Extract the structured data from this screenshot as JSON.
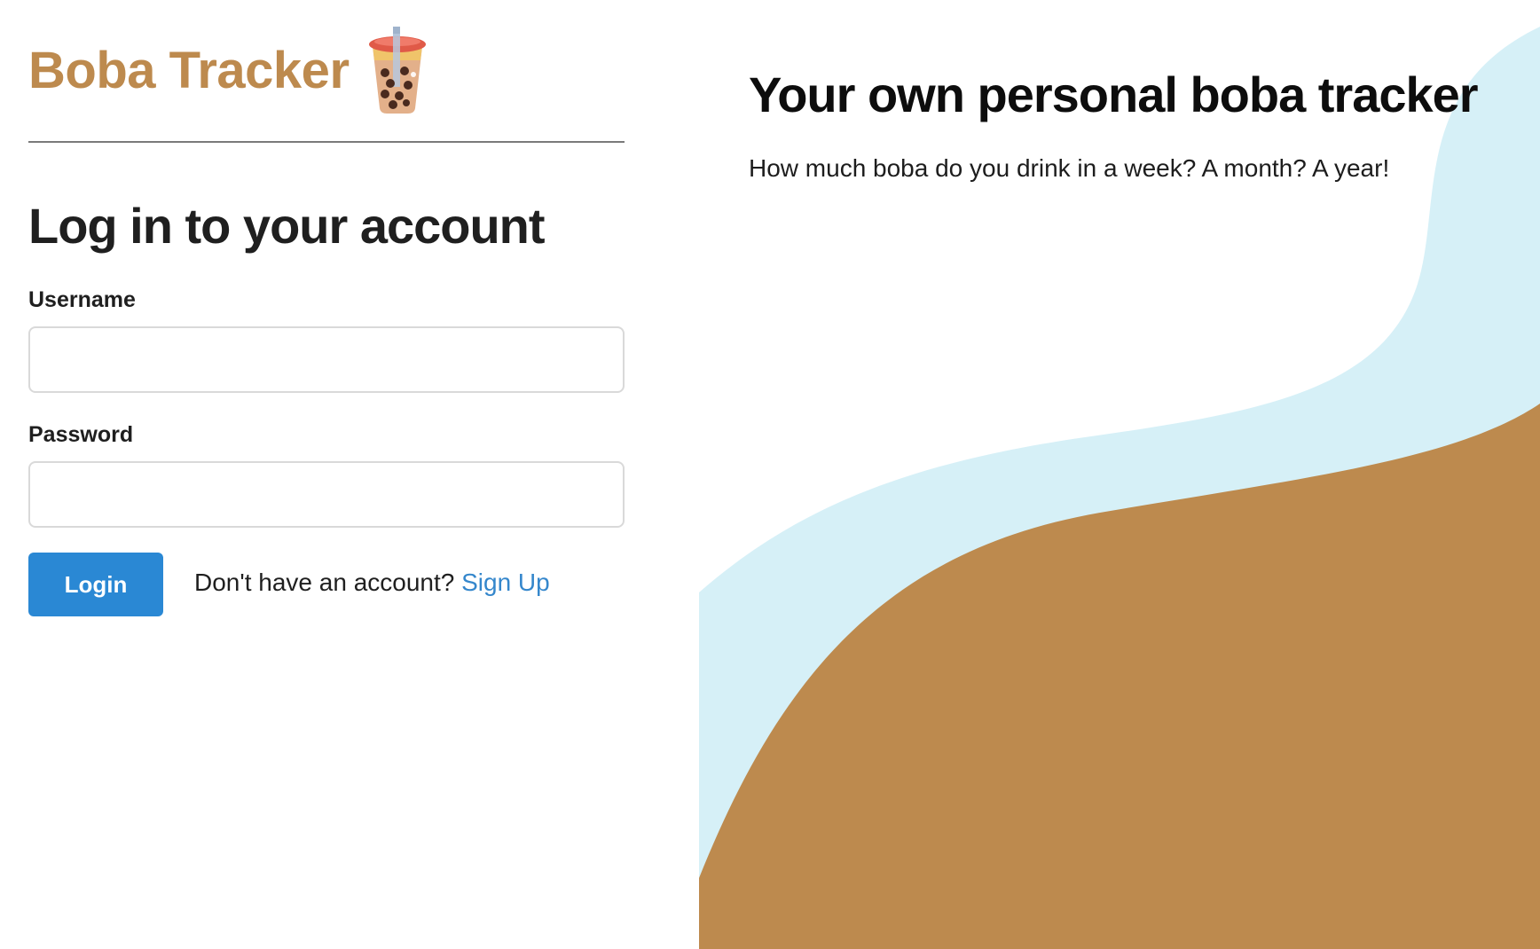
{
  "app": {
    "brand_title": "Boba Tracker",
    "brand_icon": "bubble-tea-icon",
    "brand_color": "#bd8a4e"
  },
  "login_form": {
    "heading": "Log in to your account",
    "username_label": "Username",
    "username_value": "",
    "password_label": "Password",
    "password_value": "",
    "login_button_label": "Login",
    "signup_prompt": "Don't have an account?",
    "signup_link_label": "Sign Up",
    "button_color": "#2a88d4",
    "link_color": "#3587cc"
  },
  "hero": {
    "title": "Your own personal boba tracker",
    "subtitle": "How much boba do you drink in a week? A month? A year!",
    "wave_light_color": "#d6f0f7",
    "wave_dark_color": "#bd8a4e"
  }
}
